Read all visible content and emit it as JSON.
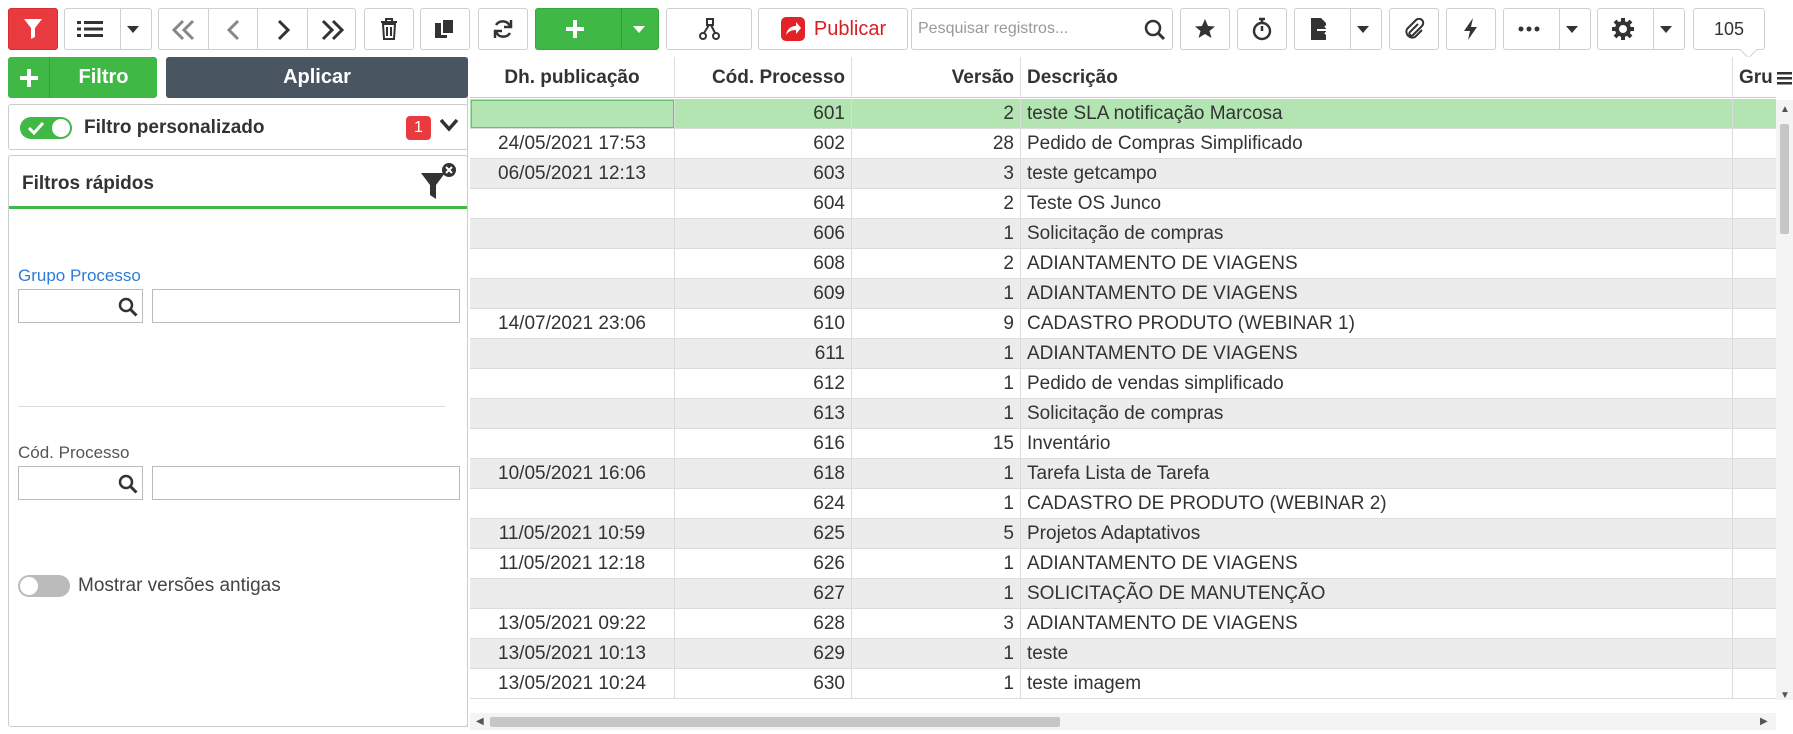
{
  "toolbar": {
    "publish_label": "Publicar",
    "search_placeholder": "Pesquisar registros...",
    "record_count": "105"
  },
  "left_panel": {
    "filter_button": "Filtro",
    "apply_button": "Aplicar",
    "custom_filter": {
      "title": "Filtro personalizado",
      "badge": "1"
    },
    "quick_filters": {
      "title": "Filtros rápidos",
      "group_label": "Grupo Processo",
      "code_label": "Cód. Processo",
      "old_versions_label": "Mostrar versões antigas"
    }
  },
  "grid": {
    "columns": [
      "Dh. publicação",
      "Cód. Processo",
      "Versão",
      "Descrição",
      "Gru"
    ],
    "rows": [
      {
        "date": "",
        "code": "601",
        "version": "2",
        "desc": "teste SLA notificação Marcosa",
        "selected": true
      },
      {
        "date": "24/05/2021 17:53",
        "code": "602",
        "version": "28",
        "desc": "Pedido de Compras Simplificado"
      },
      {
        "date": "06/05/2021 12:13",
        "code": "603",
        "version": "3",
        "desc": "teste getcampo"
      },
      {
        "date": "",
        "code": "604",
        "version": "2",
        "desc": "Teste OS Junco"
      },
      {
        "date": "",
        "code": "606",
        "version": "1",
        "desc": "Solicitação de compras"
      },
      {
        "date": "",
        "code": "608",
        "version": "2",
        "desc": "ADIANTAMENTO DE VIAGENS"
      },
      {
        "date": "",
        "code": "609",
        "version": "1",
        "desc": "ADIANTAMENTO DE VIAGENS"
      },
      {
        "date": "14/07/2021 23:06",
        "code": "610",
        "version": "9",
        "desc": "CADASTRO PRODUTO (WEBINAR 1)"
      },
      {
        "date": "",
        "code": "611",
        "version": "1",
        "desc": "ADIANTAMENTO DE VIAGENS"
      },
      {
        "date": "",
        "code": "612",
        "version": "1",
        "desc": "Pedido de vendas simplificado"
      },
      {
        "date": "",
        "code": "613",
        "version": "1",
        "desc": "Solicitação de compras"
      },
      {
        "date": "",
        "code": "616",
        "version": "15",
        "desc": "Inventário"
      },
      {
        "date": "10/05/2021 16:06",
        "code": "618",
        "version": "1",
        "desc": "Tarefa Lista de Tarefa"
      },
      {
        "date": "",
        "code": "624",
        "version": "1",
        "desc": "CADASTRO DE PRODUTO (WEBINAR 2)"
      },
      {
        "date": "11/05/2021 10:59",
        "code": "625",
        "version": "5",
        "desc": "Projetos Adaptativos"
      },
      {
        "date": "11/05/2021 12:18",
        "code": "626",
        "version": "1",
        "desc": "ADIANTAMENTO DE VIAGENS"
      },
      {
        "date": "",
        "code": "627",
        "version": "1",
        "desc": "SOLICITAÇÃO DE MANUTENÇÃO"
      },
      {
        "date": "13/05/2021 09:22",
        "code": "628",
        "version": "3",
        "desc": "ADIANTAMENTO DE VIAGENS"
      },
      {
        "date": "13/05/2021 10:13",
        "code": "629",
        "version": "1",
        "desc": "teste"
      },
      {
        "date": "13/05/2021 10:24",
        "code": "630",
        "version": "1",
        "desc": "teste imagem"
      }
    ]
  }
}
